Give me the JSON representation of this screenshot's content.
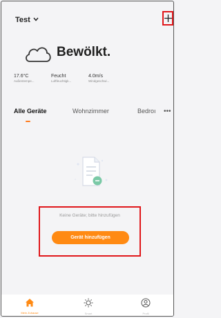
{
  "header": {
    "home_name": "Test",
    "add_icon": "plus-icon",
    "chevron_icon": "chevron-down-icon"
  },
  "weather": {
    "icon": "cloud-icon",
    "condition": "Bewölkt.",
    "stats": [
      {
        "value": "17.6°C",
        "label": "Außentempe..."
      },
      {
        "value": "Feucht",
        "label": "Luftfeuchtigk..."
      },
      {
        "value": "4.0m/s",
        "label": "Windgeschwi..."
      }
    ]
  },
  "tabs": {
    "items": [
      "Alle Geräte",
      "Wohnzimmer",
      "Bedroı"
    ],
    "more_label": "•••"
  },
  "empty_state": {
    "illustration": "document-icon",
    "message": "Keine Geräte; bitte hinzufügen",
    "button_label": "Gerät hinzufügen"
  },
  "bottom_nav": {
    "items": [
      {
        "icon": "home-icon",
        "label": "Mein Zuhause"
      },
      {
        "icon": "sun-icon",
        "label": "Smart"
      },
      {
        "icon": "profile-icon",
        "label": "Profil"
      }
    ]
  },
  "colors": {
    "accent": "#ff8a13",
    "highlight_box": "#e0161a",
    "background": "#f4f4f6"
  }
}
